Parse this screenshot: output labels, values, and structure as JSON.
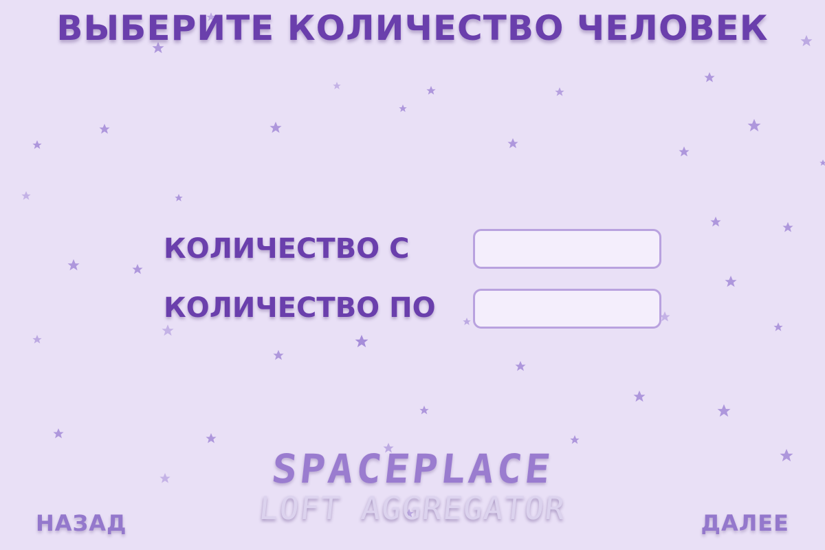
{
  "page": {
    "title": "ВЫБЕРИТЕ КОЛИЧЕСТВО ЧЕЛОВЕК"
  },
  "form": {
    "from_label": "КОЛИЧЕСТВО С",
    "from_value": "",
    "from_placeholder": "",
    "to_label": "КОЛИЧЕСТВО ПО",
    "to_value": "",
    "to_placeholder": ""
  },
  "logo": {
    "name": "SPACEPLACE",
    "tagline": "LOFT AGGREGATOR"
  },
  "navigation": {
    "back_label": "НАЗАД",
    "next_label": "ДАЛЕЕ"
  },
  "colors": {
    "background": "#e9e0f6",
    "primary_text": "#6a3fac",
    "secondary_text": "#9478cc",
    "input_border": "#b9a2df",
    "input_fill": "#f4eefc",
    "star": "#9f84d6"
  },
  "decoration": {
    "background_icon": "star-icon"
  }
}
